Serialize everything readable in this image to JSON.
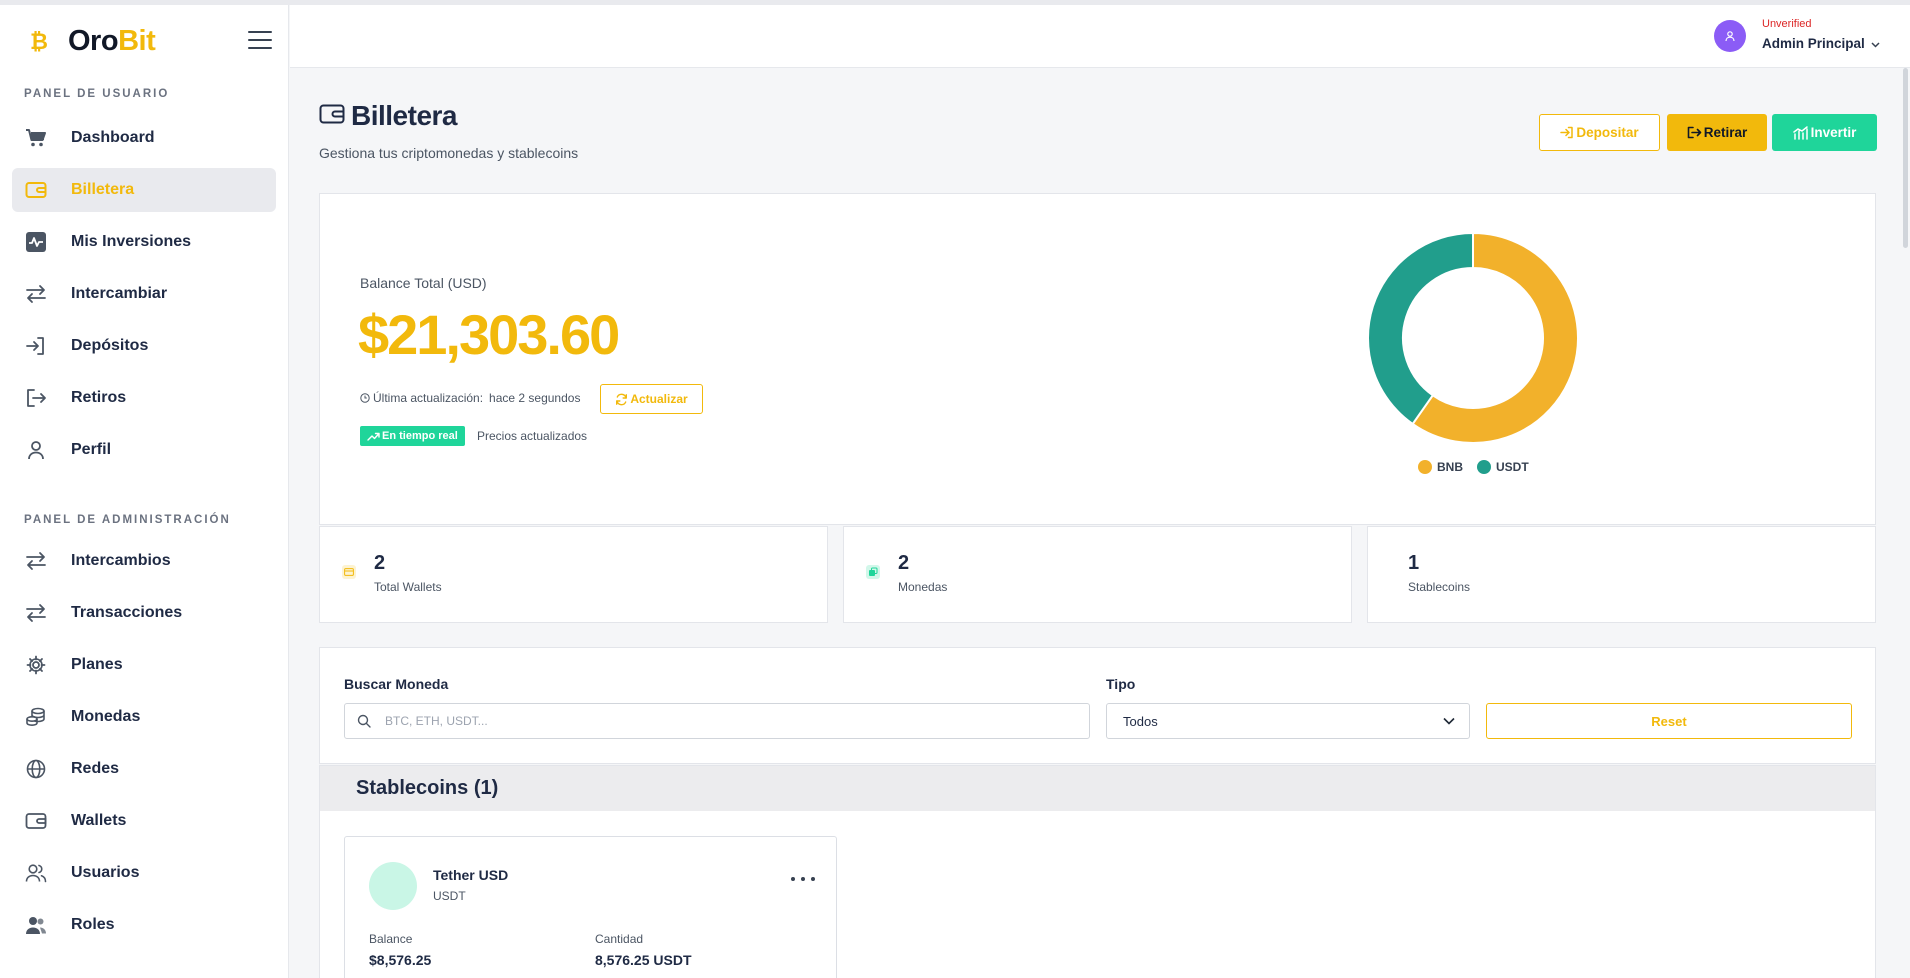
{
  "brand": {
    "prefix": "Oro",
    "suffix": "Bit",
    "accent_color": "#f2b90c"
  },
  "sidebar": {
    "user_section": "PANEL DE USUARIO",
    "user_items": [
      {
        "label": "Dashboard",
        "icon": "cart-icon"
      },
      {
        "label": "Billetera",
        "icon": "wallet-icon",
        "active": true
      },
      {
        "label": "Mis Inversiones",
        "icon": "activity-icon"
      },
      {
        "label": "Intercambiar",
        "icon": "arrows-icon"
      },
      {
        "label": "Depósitos",
        "icon": "login-icon"
      },
      {
        "label": "Retiros",
        "icon": "logout-icon"
      },
      {
        "label": "Perfil",
        "icon": "user-icon"
      }
    ],
    "admin_section": "PANEL DE ADMINISTRACIÓN",
    "admin_items": [
      {
        "label": "Intercambios",
        "icon": "arrows-icon"
      },
      {
        "label": "Transacciones",
        "icon": "arrows-icon"
      },
      {
        "label": "Planes",
        "icon": "gear-icon"
      },
      {
        "label": "Monedas",
        "icon": "coins-icon"
      },
      {
        "label": "Redes",
        "icon": "globe-icon"
      },
      {
        "label": "Wallets",
        "icon": "wallet-icon"
      },
      {
        "label": "Usuarios",
        "icon": "users-icon"
      },
      {
        "label": "Roles",
        "icon": "roles-icon"
      }
    ]
  },
  "header": {
    "status": "Unverified",
    "user_name": "Admin Principal"
  },
  "page": {
    "title": "Billetera",
    "subtitle": "Gestiona tus criptomonedas y stablecoins",
    "deposit_label": "Depositar",
    "withdraw_label": "Retirar",
    "invest_label": "Invertir"
  },
  "balance": {
    "label": "Balance Total (USD)",
    "amount": "$21,303.60",
    "updated_label": "Última actualización:",
    "updated_value": "hace 2 segundos",
    "refresh_label": "Actualizar",
    "realtime_badge": "En tiempo real",
    "realtime_text": "Precios actualizados"
  },
  "chart_data": {
    "type": "pie",
    "variant": "donut",
    "categories": [
      "BNB",
      "USDT"
    ],
    "values": [
      12727.35,
      8576.25
    ],
    "colors": [
      "#f2b12b",
      "#219e8c"
    ],
    "legend": "bottom"
  },
  "stats": [
    {
      "value": "2",
      "label": "Total Wallets",
      "icon": "wallet-icon",
      "color": "#f2b90c"
    },
    {
      "value": "2",
      "label": "Monedas",
      "icon": "coins-icon",
      "color": "#1fd59a"
    },
    {
      "value": "1",
      "label": "Stablecoins"
    }
  ],
  "filters": {
    "search_label": "Buscar Moneda",
    "search_placeholder": "BTC, ETH, USDT...",
    "type_label": "Tipo",
    "type_value": "Todos",
    "reset_label": "Reset"
  },
  "groups": [
    {
      "title": "Stablecoins (1)",
      "coins": [
        {
          "name": "Tether USD",
          "symbol": "USDT",
          "balance_label": "Balance",
          "balance": "$8,576.25",
          "amount_label": "Cantidad",
          "amount": "8,576.25 USDT"
        }
      ]
    }
  ]
}
